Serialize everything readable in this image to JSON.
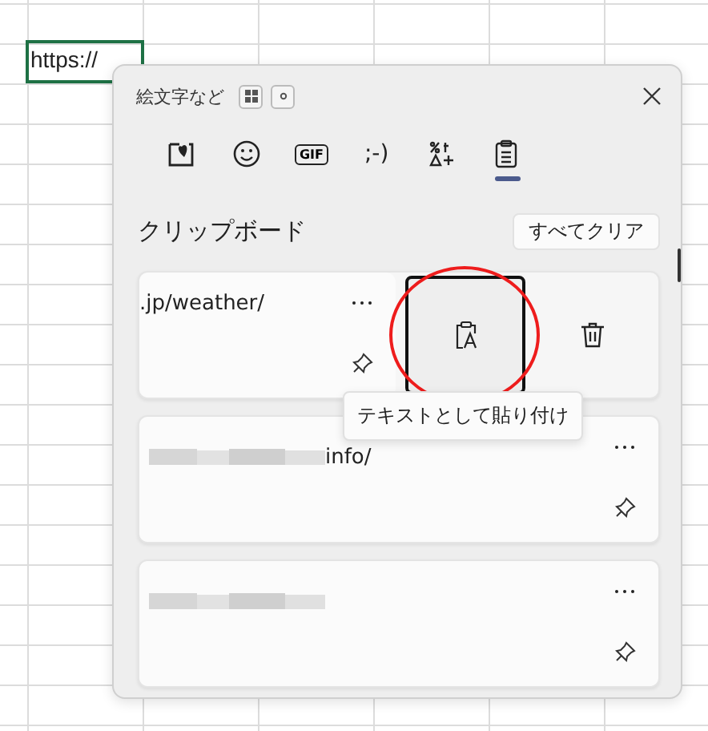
{
  "cell": {
    "text": "https://",
    "selected": true
  },
  "panel": {
    "title": "絵文字など",
    "tabs": [
      {
        "kind": "sticker",
        "selected": false
      },
      {
        "kind": "emoji",
        "selected": false
      },
      {
        "kind": "gif",
        "label": "GIF",
        "selected": false
      },
      {
        "kind": "kaomoji",
        "label": ";-)",
        "selected": false
      },
      {
        "kind": "symbols",
        "selected": false
      },
      {
        "kind": "clipboard",
        "selected": true
      }
    ],
    "section_title": "クリップボード",
    "clear_button": "すべてクリア",
    "items": [
      {
        "text": ".jp/weather/",
        "blurred": false,
        "expanded": true,
        "tooltip": "テキストとして貼り付け"
      },
      {
        "text": "info/",
        "blurred": true,
        "expanded": false
      },
      {
        "blurred": true,
        "expanded": false
      }
    ]
  }
}
